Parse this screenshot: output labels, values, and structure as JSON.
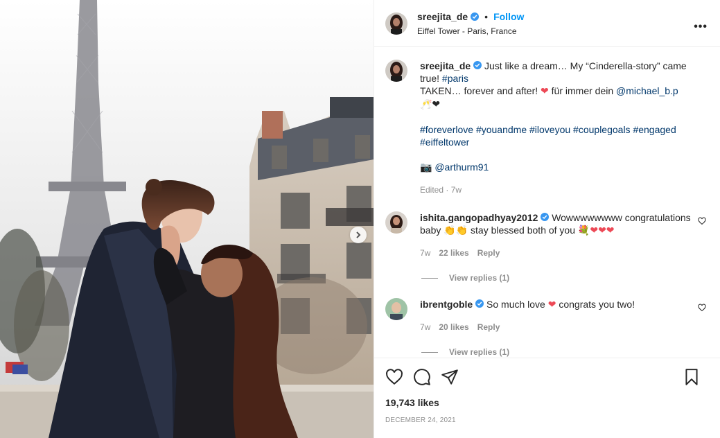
{
  "colors": {
    "accent": "#0095f6",
    "link": "#00376b",
    "heart": "#ed4956",
    "muted": "#8e8e8e"
  },
  "header": {
    "username": "sreejita_de",
    "separator": "•",
    "follow_label": "Follow",
    "location": "Eiffel Tower - Paris, France",
    "more_label": "•••"
  },
  "caption": {
    "username": "sreejita_de",
    "line1_text": "Just like a dream… My “Cinderella-story” came true!",
    "line1_tag": "#paris",
    "line2_a": "TAKEN… forever and after!",
    "line2_heart": "❤",
    "line2_b": "für immer dein",
    "line2_mention": "@michael_b.p",
    "line2_emoji": "🥂❤",
    "tags": [
      "#foreverlove",
      "#youandme",
      "#iloveyou",
      "#couplegoals",
      "#engaged",
      "#eiffeltower"
    ],
    "camera_emoji": "📷",
    "credit": "@arthurm91",
    "meta": "Edited · 7w"
  },
  "comments": [
    {
      "username": "ishita.gangopadhyay2012",
      "text_a": "Wowwwwwwww congratulations baby",
      "emoji_a": "👏👏",
      "text_b": "stay blessed both of you",
      "emoji_b": "💐❤❤❤",
      "age": "7w",
      "likes": "22 likes",
      "reply": "Reply",
      "view_replies": "View replies (1)"
    },
    {
      "username": "ibrentgoble",
      "text_a": "So much love",
      "emoji_a": "❤",
      "text_b": "congrats you two!",
      "age": "7w",
      "likes": "20 likes",
      "reply": "Reply",
      "view_replies": "View replies (1)"
    }
  ],
  "footer": {
    "likes": "19,743 likes",
    "date": "DECEMBER 24, 2021"
  },
  "icons": {
    "like": "heart-icon",
    "comment": "comment-icon",
    "share": "share-icon",
    "save": "bookmark-icon",
    "verified": "verified-badge-icon",
    "next": "chevron-right-icon"
  }
}
